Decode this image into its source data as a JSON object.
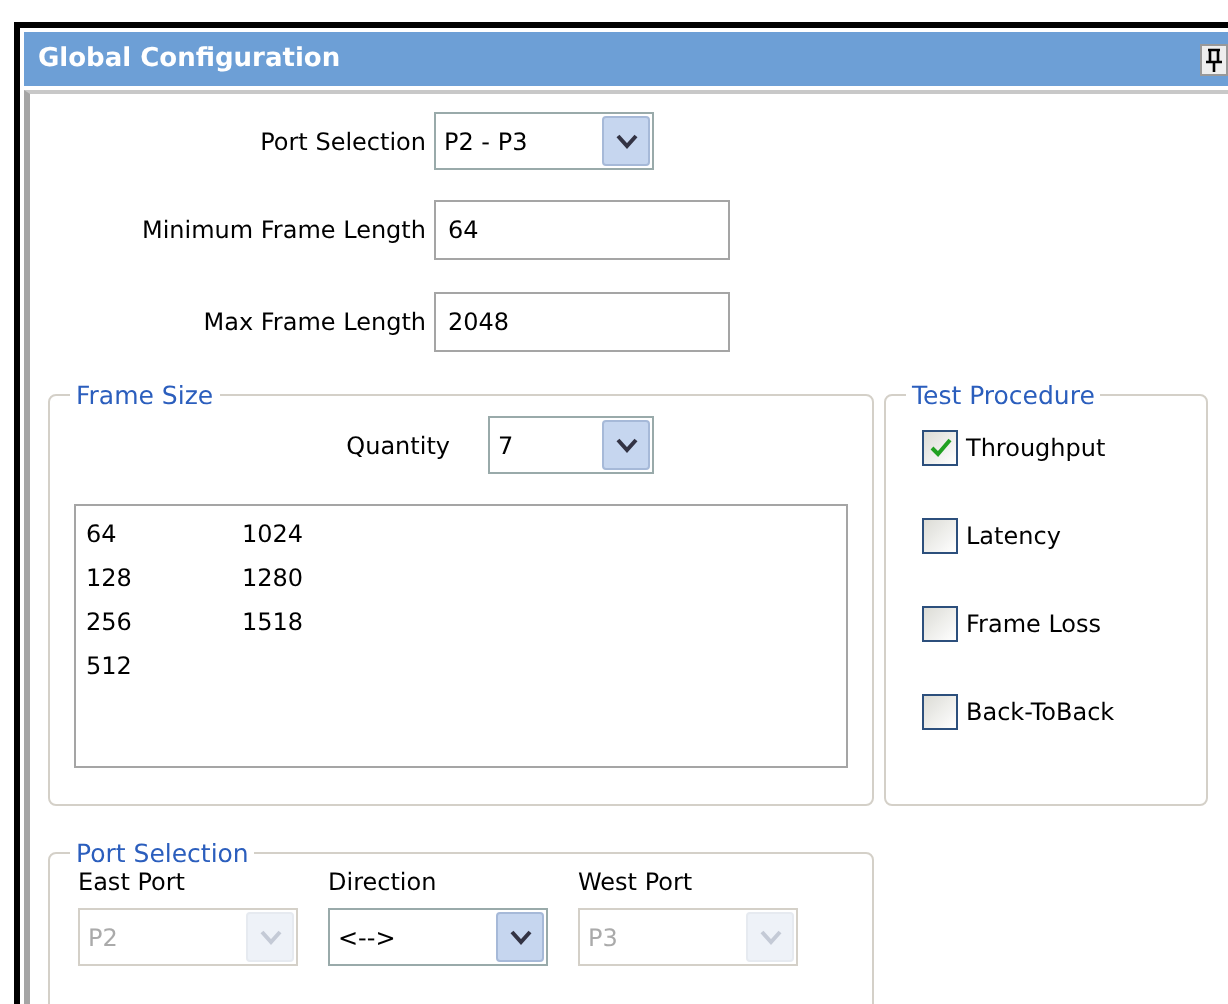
{
  "window": {
    "title": "Global Configuration"
  },
  "port_selection": {
    "label": "Port Selection",
    "value": "P2 - P3"
  },
  "min_frame_length": {
    "label": "Minimum Frame Length",
    "value": "64"
  },
  "max_frame_length": {
    "label": "Max Frame Length",
    "value": "2048"
  },
  "frame_size": {
    "title": "Frame Size",
    "quantity_label": "Quantity",
    "quantity": "7",
    "sizes": [
      "64",
      "128",
      "256",
      "512",
      "1024",
      "1280",
      "1518"
    ]
  },
  "test_procedure": {
    "title": "Test Procedure",
    "items": [
      {
        "label": "Throughput",
        "checked": true
      },
      {
        "label": "Latency",
        "checked": false
      },
      {
        "label": "Frame Loss",
        "checked": false
      },
      {
        "label": "Back-ToBack",
        "checked": false
      }
    ]
  },
  "ports": {
    "title": "Port Selection",
    "fields": [
      {
        "label": "East Port",
        "value": "P2",
        "disabled": true
      },
      {
        "label": "Direction",
        "value": "<-->",
        "disabled": false
      },
      {
        "label": "West Port",
        "value": "P3",
        "disabled": true
      }
    ]
  }
}
